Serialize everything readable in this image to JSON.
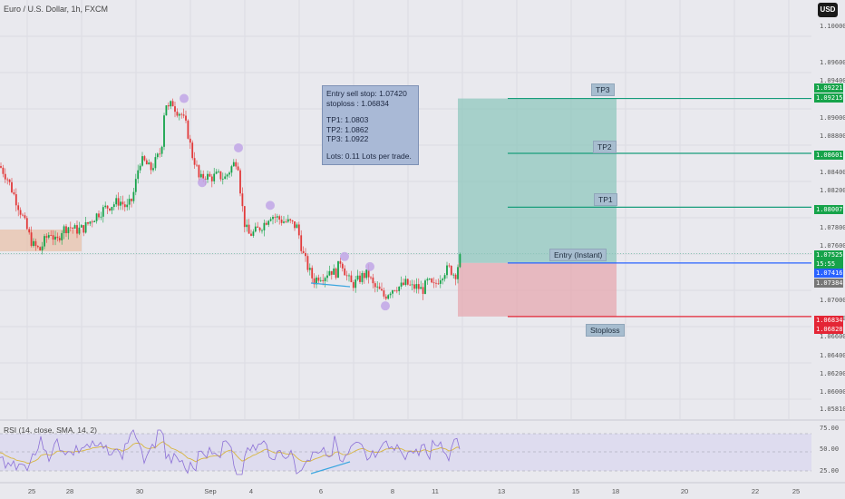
{
  "header": {
    "title": "Euro / U.S. Dollar, 1h, FXCM",
    "currency": "USD"
  },
  "info_box": {
    "line1": "Entry sell stop: 1.07420",
    "line2": "stoploss : 1.06834",
    "tp1": "TP1: 1.0803",
    "tp2": "TP2: 1.0862",
    "tp3": "TP3: 1.0922",
    "lots": "Lots: 0.11 Lots per trade."
  },
  "levels": {
    "tp3": "TP3",
    "tp2": "TP2",
    "tp1": "TP1",
    "entry": "Entry (Instant)",
    "stoploss": "Stoploss"
  },
  "price_tags": {
    "tp3_a": "1.09221",
    "tp3_b": "1.09215",
    "tp2": "1.08601",
    "tp1": "1.08007",
    "current": "1.07525",
    "countdown": "15:55",
    "entry": "1.07416",
    "grey": "1.07384",
    "sl_a": "1.06834",
    "sl_b": "1.06828"
  },
  "colors": {
    "background": "#e9e9ee",
    "bull": "#16a34a",
    "bear": "#e23a3a",
    "target_zone": "#8fc7bd",
    "stop_zone": "#e5a8b0",
    "target_line": "#189d7b",
    "entry_line": "#2962ff",
    "stop_line": "#e42535",
    "rsi_line": "#8b6fd6",
    "rsi_ma": "#d8b640"
  },
  "rsi": {
    "title": "RSI (14, close, SMA, 14, 2)",
    "ticks": [
      "75.00",
      "50.00",
      "25.00"
    ]
  },
  "chart_data": {
    "type": "candlestick",
    "title": "Euro / U.S. Dollar, 1h, FXCM",
    "y_axis_ticks": [
      "1.10000",
      "1.09600",
      "1.09400",
      "1.09000",
      "1.08800",
      "1.08400",
      "1.08200",
      "1.07800",
      "1.07600",
      "1.07000",
      "1.06800",
      "1.06600",
      "1.06400",
      "1.06200",
      "1.06000",
      "1.05810"
    ],
    "ylim": [
      1.058,
      1.1015
    ],
    "x_axis_ticks": [
      "25",
      "28",
      "30",
      "Sep",
      "4",
      "6",
      "8",
      "11",
      "13",
      "15",
      "18",
      "20",
      "22",
      "25"
    ],
    "price_path": [
      [
        0,
        1.0848
      ],
      [
        8,
        1.0835
      ],
      [
        16,
        1.0815
      ],
      [
        24,
        1.0795
      ],
      [
        30,
        1.0778
      ],
      [
        36,
        1.0762
      ],
      [
        44,
        1.0756
      ],
      [
        50,
        1.0768
      ],
      [
        56,
        1.0776
      ],
      [
        62,
        1.0763
      ],
      [
        68,
        1.0778
      ],
      [
        76,
        1.0782
      ],
      [
        84,
        1.0778
      ],
      [
        92,
        1.078
      ],
      [
        100,
        1.0788
      ],
      [
        108,
        1.0796
      ],
      [
        116,
        1.0802
      ],
      [
        124,
        1.0806
      ],
      [
        132,
        1.081
      ],
      [
        140,
        1.0802
      ],
      [
        146,
        1.0812
      ],
      [
        150,
        1.0832
      ],
      [
        154,
        1.0854
      ],
      [
        160,
        1.0852
      ],
      [
        166,
        1.0844
      ],
      [
        172,
        1.0854
      ],
      [
        178,
        1.0866
      ],
      [
        182,
        1.092
      ],
      [
        186,
        1.091
      ],
      [
        190,
        1.0918
      ],
      [
        194,
        1.091
      ],
      [
        200,
        1.0905
      ],
      [
        206,
        1.089
      ],
      [
        212,
        1.086
      ],
      [
        216,
        1.085
      ],
      [
        220,
        1.0832
      ],
      [
        226,
        1.0838
      ],
      [
        232,
        1.0835
      ],
      [
        240,
        1.0838
      ],
      [
        248,
        1.0835
      ],
      [
        256,
        1.0848
      ],
      [
        262,
        1.0856
      ],
      [
        266,
        1.0812
      ],
      [
        270,
        1.0784
      ],
      [
        274,
        1.0773
      ],
      [
        280,
        1.0775
      ],
      [
        286,
        1.078
      ],
      [
        292,
        1.0786
      ],
      [
        298,
        1.0795
      ],
      [
        304,
        1.0792
      ],
      [
        312,
        1.0788
      ],
      [
        320,
        1.0786
      ],
      [
        328,
        1.0781
      ],
      [
        334,
        1.0752
      ],
      [
        340,
        1.0736
      ],
      [
        346,
        1.0722
      ],
      [
        352,
        1.0728
      ],
      [
        358,
        1.0728
      ],
      [
        364,
        1.0735
      ],
      [
        370,
        1.073
      ],
      [
        376,
        1.0746
      ],
      [
        382,
        1.0728
      ],
      [
        388,
        1.0718
      ],
      [
        394,
        1.0722
      ],
      [
        400,
        1.0728
      ],
      [
        406,
        1.073
      ],
      [
        412,
        1.0716
      ],
      [
        418,
        1.0712
      ],
      [
        424,
        1.0705
      ],
      [
        430,
        1.0712
      ],
      [
        436,
        1.0716
      ],
      [
        442,
        1.0716
      ],
      [
        448,
        1.072
      ],
      [
        454,
        1.0715
      ],
      [
        460,
        1.0716
      ],
      [
        466,
        1.0712
      ],
      [
        472,
        1.0722
      ],
      [
        478,
        1.0715
      ],
      [
        484,
        1.0725
      ],
      [
        490,
        1.0733
      ],
      [
        496,
        1.0736
      ],
      [
        502,
        1.0728
      ],
      [
        506,
        1.0743
      ],
      [
        509,
        1.0752
      ]
    ],
    "trade_setup": {
      "entry_sell_stop": 1.0742,
      "stoploss": 1.06834,
      "tp1": 1.0803,
      "tp2": 1.0862,
      "tp3": 1.0922,
      "lots": 0.11
    }
  }
}
